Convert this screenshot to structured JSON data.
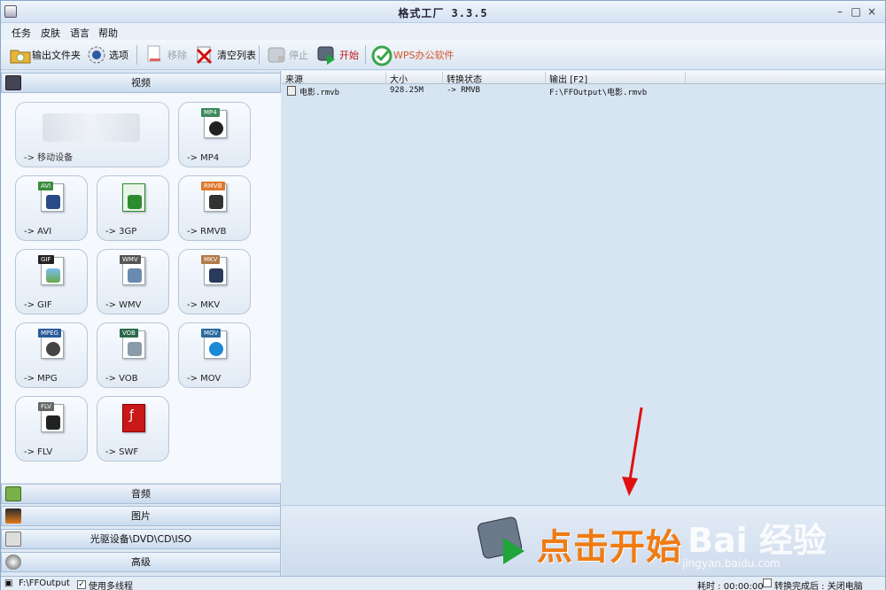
{
  "window": {
    "title": "格式工厂  3.3.5",
    "min": "–",
    "max": "□",
    "close": "×"
  },
  "menu": [
    "任务",
    "皮肤",
    "语言",
    "帮助"
  ],
  "toolbar": {
    "output_folder": "输出文件夹",
    "options": "选项",
    "remove": "移除",
    "clear_list": "清空列表",
    "stop": "停止",
    "start": "开始",
    "wps": "WPS办公软件"
  },
  "categories": {
    "video": "视频",
    "audio": "音频",
    "image": "图片",
    "rom": "光驱设备\\DVD\\CD\\ISO",
    "advanced": "高级"
  },
  "formats": [
    {
      "label": "-> 移动设备",
      "tag": "",
      "color": "#8aa"
    },
    {
      "label": "-> MP4",
      "tag": "MP4",
      "color": "#3a8a5a"
    },
    {
      "label": "-> AVI",
      "tag": "AVI",
      "color": "#3a8a3a"
    },
    {
      "label": "-> 3GP",
      "tag": "",
      "color": "#2e8b2e"
    },
    {
      "label": "-> RMVB",
      "tag": "RMVB",
      "color": "#e0762a"
    },
    {
      "label": "-> GIF",
      "tag": "GIF",
      "color": "#333"
    },
    {
      "label": "-> WMV",
      "tag": "WMV",
      "color": "#555"
    },
    {
      "label": "-> MKV",
      "tag": "MKV",
      "color": "#b07a4a"
    },
    {
      "label": "-> MPG",
      "tag": "MPEG",
      "color": "#2a5a9a"
    },
    {
      "label": "-> VOB",
      "tag": "VOB",
      "color": "#2a6a4a"
    },
    {
      "label": "-> MOV",
      "tag": "MOV",
      "color": "#2a6aa0"
    },
    {
      "label": "-> FLV",
      "tag": "FLV",
      "color": "#666"
    },
    {
      "label": "-> SWF",
      "tag": "",
      "color": "#c81818"
    }
  ],
  "list": {
    "headers": [
      "来源",
      "大小",
      "转换状态",
      "输出 [F2]"
    ],
    "rows": [
      {
        "source": "电影.rmvb",
        "size": "928.25M",
        "status": "-> RMVB",
        "output": "F:\\FFOutput\\电影.rmvb"
      }
    ]
  },
  "banner": {
    "text": "点击开始"
  },
  "watermark": {
    "brand": "Bai  经验",
    "url": "jingyan.baidu.com"
  },
  "status": {
    "path": "F:\\FFOutput",
    "multithread": "使用多线程",
    "multithread_checked": "✓",
    "elapsed": "耗时 : 00:00:00",
    "after": "转换完成后 : 关闭电脑"
  }
}
